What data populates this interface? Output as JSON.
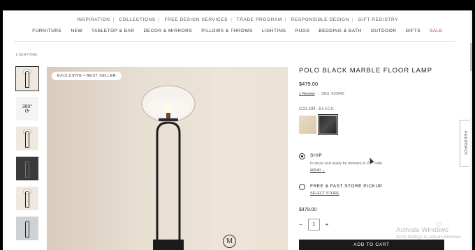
{
  "utility_nav": [
    "INSPIRATION",
    "COLLECTIONS",
    "FREE DESIGN SERVICES",
    "TRADE PROGRAM",
    "RESPONSIBLE DESIGN",
    "GIFT REGISTRY"
  ],
  "main_nav": [
    "FURNITURE",
    "NEW",
    "TABLETOP & BAR",
    "DECOR & MIRRORS",
    "PILLOWS & THROWS",
    "LIGHTING",
    "RUGS",
    "BEDDING & BATH",
    "OUTDOOR",
    "GIFTS",
    "SALE"
  ],
  "breadcrumb": "LIGHTING",
  "hero": {
    "badge": "EXCLUSIVE • BEST SELLER",
    "brand_mark": "M"
  },
  "thumb_360": "360°",
  "product": {
    "title": "POLO BLACK MARBLE FLOOR LAMP",
    "price": "$479.00",
    "reviews": "1 Review",
    "sku": "SKU: 620545",
    "color_label": "COLOR:",
    "color_value": "BLACK"
  },
  "ship": {
    "title": "SHIP",
    "subtitle": "In stock and ready for delivery to ZIP code",
    "zip": "60540"
  },
  "pickup": {
    "title": "FREE & FAST STORE PICKUP",
    "link": "SELECT STORE"
  },
  "cart": {
    "price": "$479.00",
    "quantity": "1",
    "minus": "−",
    "plus": "+",
    "button": "ADD TO CART"
  },
  "feedback": "FEEDBACK",
  "watermark": {
    "line1": "Activate Windows",
    "line2": "Go to Settings to activate Windows."
  }
}
